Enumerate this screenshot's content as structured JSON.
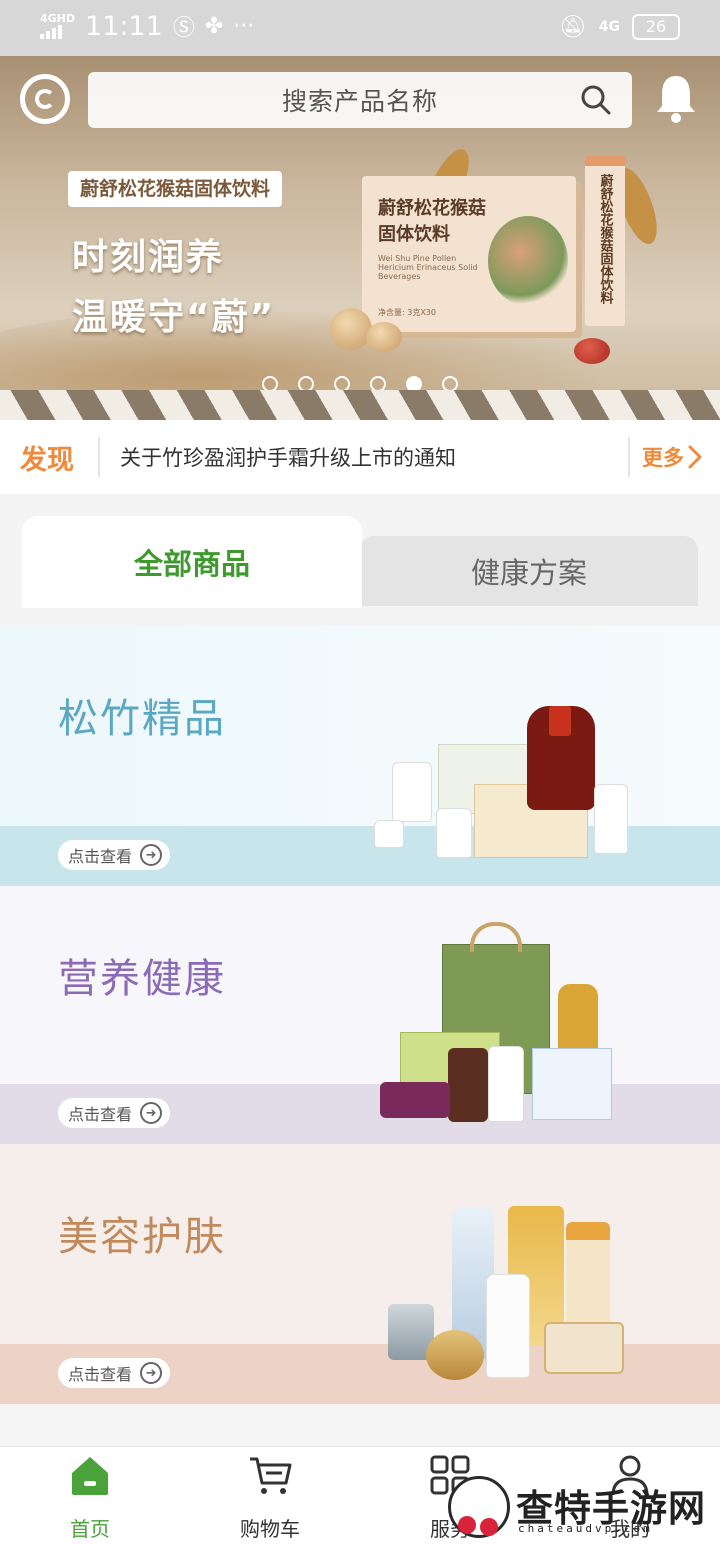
{
  "status_bar": {
    "network": "4GHD",
    "time": "11:11",
    "extra": "···",
    "network_right": "4G",
    "battery": "26"
  },
  "header": {
    "search_placeholder": "搜索产品名称"
  },
  "banner": {
    "tag": "蔚舒松花猴菇固体饮料",
    "line1": "时刻润养",
    "line2": "温暖守“蔚”",
    "box_title": "蔚舒松花猴菇固体饮料",
    "box_subtitle": "Wei Shu Pine Pollen Hericium Erinaceus Solid Beverages",
    "box_net": "净含量: 3克X30",
    "tube_text": "蔚舒松花猴菇固体饮料",
    "dots": 6,
    "active_dot": 4
  },
  "notice": {
    "label": "发现",
    "text": "关于竹珍盈润护手霜升级上市的通知",
    "more": "更多"
  },
  "tabs": {
    "active": "全部商品",
    "inactive": "健康方案"
  },
  "categories": [
    {
      "title": "松竹精品",
      "button": "点击查看"
    },
    {
      "title": "营养健康",
      "button": "点击查看"
    },
    {
      "title": "美容护肤",
      "button": "点击查看"
    }
  ],
  "bottom_nav": [
    {
      "label": "首页",
      "icon": "home-icon",
      "active": true
    },
    {
      "label": "购物车",
      "icon": "cart-icon",
      "active": false
    },
    {
      "label": "服务",
      "icon": "grid-icon",
      "active": false
    },
    {
      "label": "我的",
      "icon": "user-icon",
      "active": false
    }
  ],
  "watermark": {
    "title": "查特手游网",
    "url": "chateaudvp.com"
  },
  "colors": {
    "accent_green": "#4aa23a",
    "accent_orange": "#f0893a"
  }
}
